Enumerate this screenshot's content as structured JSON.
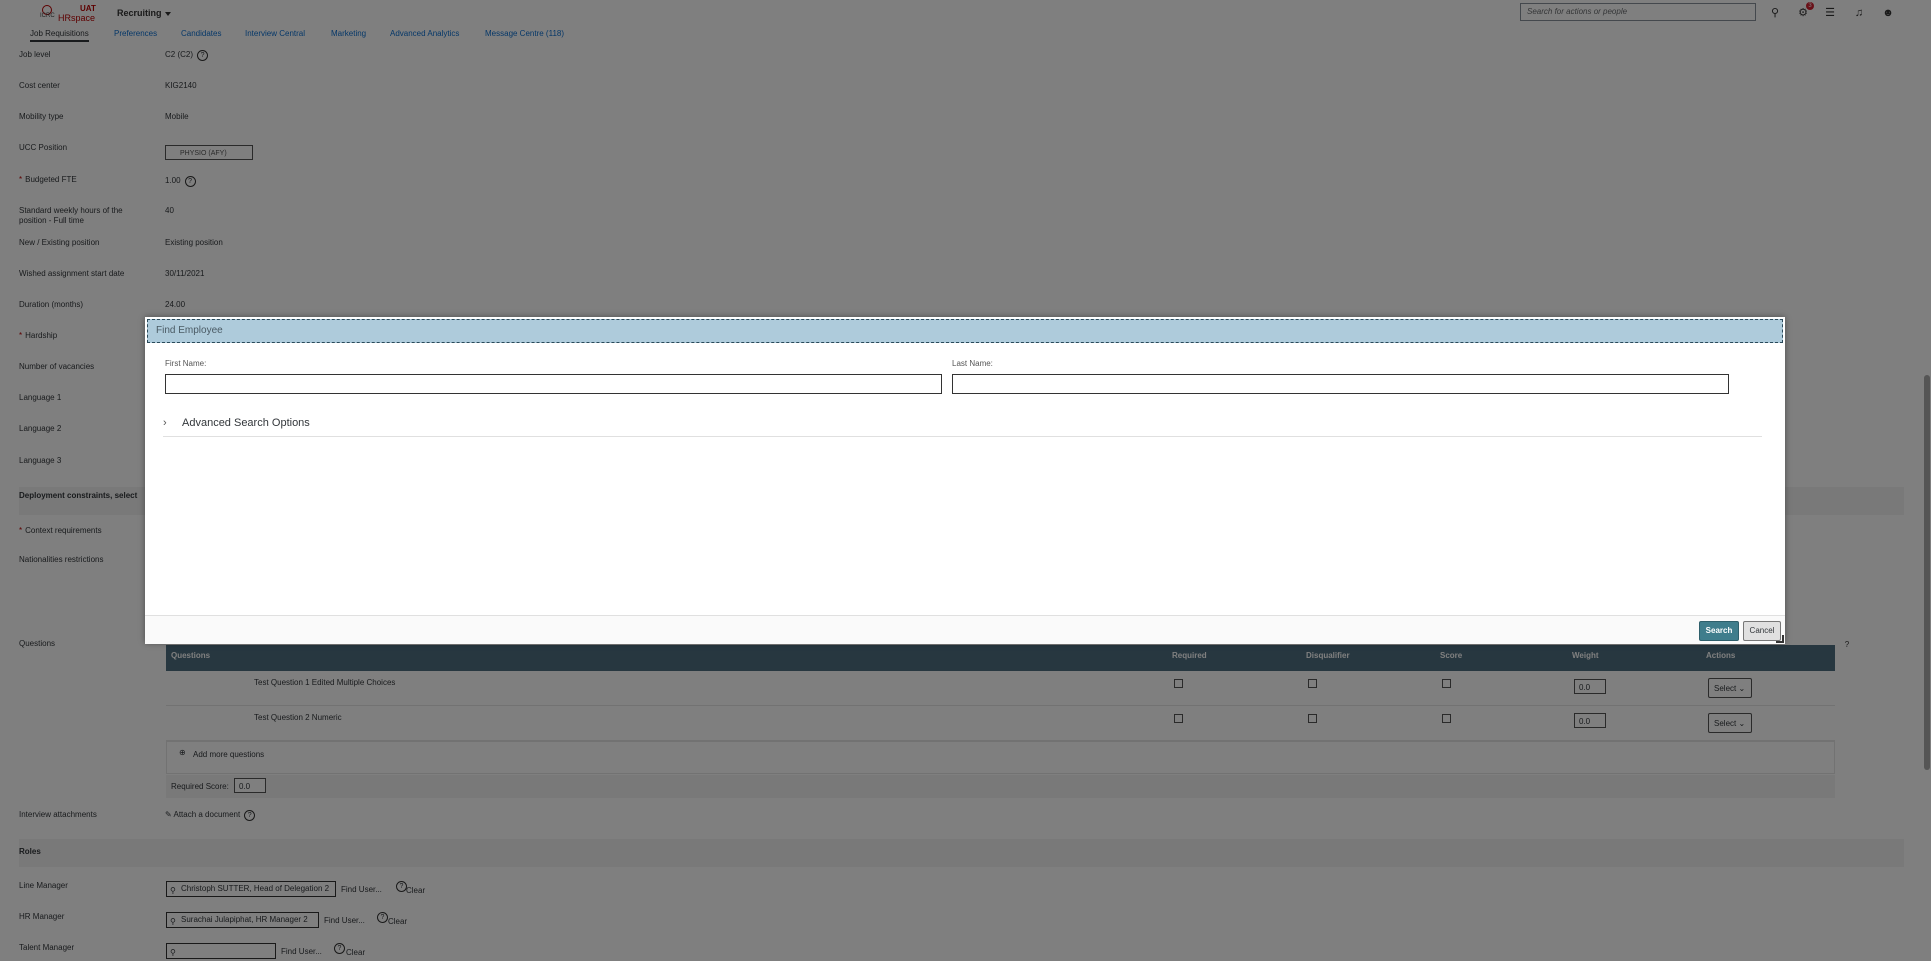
{
  "shell": {
    "logo_uat": "UAT",
    "logo_hr": "HRspace",
    "logo_icrc": "ICRC",
    "module": "Recruiting",
    "search_placeholder": "Search for actions or people",
    "badge_count": "3"
  },
  "tabs": [
    {
      "label": "Job Requisitions"
    },
    {
      "label": "Preferences"
    },
    {
      "label": "Candidates"
    },
    {
      "label": "Interview Central"
    },
    {
      "label": "Marketing"
    },
    {
      "label": "Advanced Analytics"
    },
    {
      "label": "Message Centre (118)"
    }
  ],
  "fields": [
    {
      "label": "Job level",
      "value": "C2 (C2)"
    },
    {
      "label": "Cost center",
      "value": "KIG2140"
    },
    {
      "label": "Mobility type",
      "value": "Mobile"
    },
    {
      "label": "UCC Position",
      "value": "PHYSIO (AFY)"
    },
    {
      "label": "Budgeted FTE",
      "value": "1.00"
    },
    {
      "label": "Standard weekly hours of the position - Full time",
      "value": "40"
    },
    {
      "label": "New / Existing position",
      "value": "Existing position"
    },
    {
      "label": "Wished assignment start date",
      "value": "30/11/2021"
    },
    {
      "label": "Duration (months)",
      "value": "24.00"
    },
    {
      "label": "Hardship",
      "value": ""
    },
    {
      "label": "Number of vacancies",
      "value": ""
    },
    {
      "label": "Language 1",
      "value": ""
    },
    {
      "label": "Language 2",
      "value": ""
    },
    {
      "label": "Language 3",
      "value": ""
    }
  ],
  "deployment_section": "Deployment constraints, select",
  "context_requirements": "Context requirements",
  "nationalities": "Nationalities restrictions",
  "questions_label": "Questions",
  "questions_table": {
    "headers": [
      "Questions",
      "Required",
      "Disqualifier",
      "Score",
      "Weight",
      "Actions"
    ],
    "rows": [
      {
        "text": "Test Question 1 Edited  Multiple Choices",
        "weight": "0.0",
        "action": "Select"
      },
      {
        "text": "Test Question 2  Numeric",
        "weight": "0.0",
        "action": "Select"
      }
    ],
    "add_more": "Add more questions",
    "required_score_label": "Required Score:",
    "required_score_value": "0.0"
  },
  "interview_attachments": {
    "label": "Interview attachments",
    "link": "Attach a document"
  },
  "roles": {
    "title": "Roles",
    "items": [
      {
        "label": "Line Manager",
        "value": "Christoph SUTTER, Head of Delegation 2",
        "find": "Find User...",
        "clear": "Clear"
      },
      {
        "label": "HR Manager",
        "value": "Surachai Julapiphat, HR Manager 2",
        "find": "Find User...",
        "clear": "Clear"
      },
      {
        "label": "Talent Manager",
        "value": "",
        "find": "Find User...",
        "clear": "Clear"
      }
    ]
  },
  "dialog": {
    "title": "Find Employee",
    "first_name_label": "First Name:",
    "last_name_label": "Last Name:",
    "first_name_value": "",
    "last_name_value": "",
    "advanced": "Advanced Search Options",
    "search_button": "Search",
    "cancel_button": "Cancel"
  }
}
